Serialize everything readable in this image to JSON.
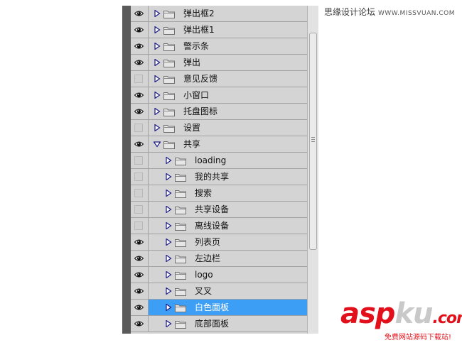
{
  "watermark": {
    "text": "思缘设计论坛",
    "url": "WWW.MISSVUAN.COM"
  },
  "layers": [
    {
      "name": "弹出框2",
      "visible": true,
      "level": 0,
      "expanded": false,
      "selected": false
    },
    {
      "name": "弹出框1",
      "visible": true,
      "level": 0,
      "expanded": false,
      "selected": false
    },
    {
      "name": "警示条",
      "visible": true,
      "level": 0,
      "expanded": false,
      "selected": false
    },
    {
      "name": "弹出",
      "visible": true,
      "level": 0,
      "expanded": false,
      "selected": false
    },
    {
      "name": "意见反馈",
      "visible": false,
      "level": 0,
      "expanded": false,
      "selected": false
    },
    {
      "name": "小窗口",
      "visible": true,
      "level": 0,
      "expanded": false,
      "selected": false
    },
    {
      "name": "托盘图标",
      "visible": true,
      "level": 0,
      "expanded": false,
      "selected": false
    },
    {
      "name": "设置",
      "visible": false,
      "level": 0,
      "expanded": false,
      "selected": false
    },
    {
      "name": "共享",
      "visible": true,
      "level": 0,
      "expanded": true,
      "selected": false
    },
    {
      "name": "loading",
      "visible": false,
      "level": 1,
      "expanded": false,
      "selected": false
    },
    {
      "name": "我的共享",
      "visible": false,
      "level": 1,
      "expanded": false,
      "selected": false
    },
    {
      "name": "搜索",
      "visible": false,
      "level": 1,
      "expanded": false,
      "selected": false
    },
    {
      "name": "共享设备",
      "visible": false,
      "level": 1,
      "expanded": false,
      "selected": false
    },
    {
      "name": "离线设备",
      "visible": false,
      "level": 1,
      "expanded": false,
      "selected": false
    },
    {
      "name": "列表页",
      "visible": true,
      "level": 1,
      "expanded": false,
      "selected": false
    },
    {
      "name": "左边栏",
      "visible": true,
      "level": 1,
      "expanded": false,
      "selected": false
    },
    {
      "name": "logo",
      "visible": true,
      "level": 1,
      "expanded": false,
      "selected": false
    },
    {
      "name": "叉叉",
      "visible": true,
      "level": 1,
      "expanded": false,
      "selected": false
    },
    {
      "name": "白色面板",
      "visible": true,
      "level": 1,
      "expanded": false,
      "selected": true
    },
    {
      "name": "底部面板",
      "visible": true,
      "level": 1,
      "expanded": false,
      "selected": false
    }
  ],
  "logo": {
    "asp": "asp",
    "ku": "ku",
    "com": ".com",
    "tagline": "免费网站源码下载站!"
  },
  "colors": {
    "selected": "#3d9ef5",
    "panel": "#d4d4d4",
    "logo_red": "#e1101a"
  }
}
